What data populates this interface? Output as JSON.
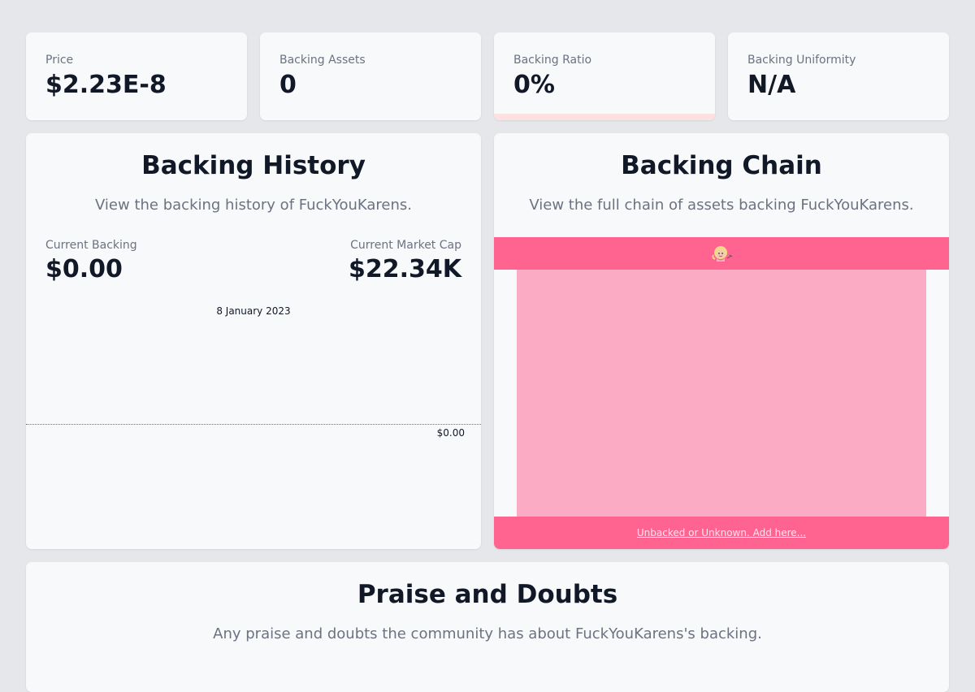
{
  "stats": [
    {
      "label": "Price",
      "value": "$2.23E-8"
    },
    {
      "label": "Backing Assets",
      "value": "0"
    },
    {
      "label": "Backing Ratio",
      "value": "0%",
      "ratio_fraction": 0
    },
    {
      "label": "Backing Uniformity",
      "value": "N/A"
    }
  ],
  "history": {
    "title": "Backing History",
    "subtitle": "View the backing history of FuckYouKarens.",
    "current_backing_label": "Current Backing",
    "current_backing_value": "$0.00",
    "market_cap_label": "Current Market Cap",
    "market_cap_value": "$22.34K",
    "chart_date": "8 January 2023",
    "chart_value_label": "$0.00"
  },
  "chain": {
    "title": "Backing Chain",
    "subtitle": "View the full chain of assets backing FuckYouKarens.",
    "token_icon": "karen-token-icon",
    "link_text": "Unbacked or Unknown. Add here..."
  },
  "praise": {
    "title": "Praise and Doubts",
    "subtitle": "Any praise and doubts the community has about FuckYouKarens's backing."
  },
  "colors": {
    "page_bg": "#e6e7eb",
    "card_bg": "#f8f9fb",
    "chain_pink": "#ff6490",
    "chain_light_pink": "#fbabc3",
    "ratio_track": "#fde0e0"
  }
}
